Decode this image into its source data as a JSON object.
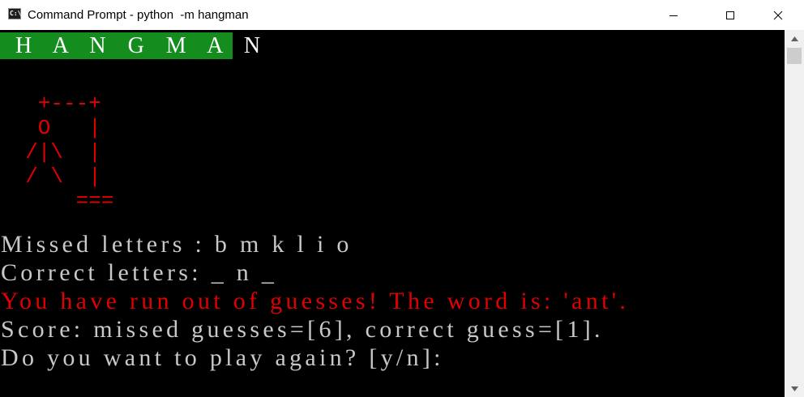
{
  "window": {
    "title": "Command Prompt - python  -m hangman",
    "icon": "cmd-icon",
    "icon_text": "C:\\",
    "controls": [
      "minimize-icon",
      "maximize-icon",
      "close-icon"
    ]
  },
  "terminal": {
    "banner": "H A N G M A N",
    "banner_bg": "#148c1e",
    "gallows": "   +---+\n   O   |\n  /|\\  |\n  / \\  |\n      ===",
    "art_color": "#e00000",
    "lines": [
      {
        "text": "Missed letters : b m k l i o",
        "color": "#c8c8c8"
      },
      {
        "text": "Correct letters: _ n _",
        "color": "#c8c8c8"
      },
      {
        "text": "You have run out of guesses! The word is: 'ant'.",
        "color": "#e00000"
      },
      {
        "text": "Score: missed guesses=[6], correct guess=[1].",
        "color": "#c8c8c8"
      },
      {
        "text": "Do you want to play again? [y/n]:",
        "color": "#c8c8c8"
      }
    ]
  }
}
